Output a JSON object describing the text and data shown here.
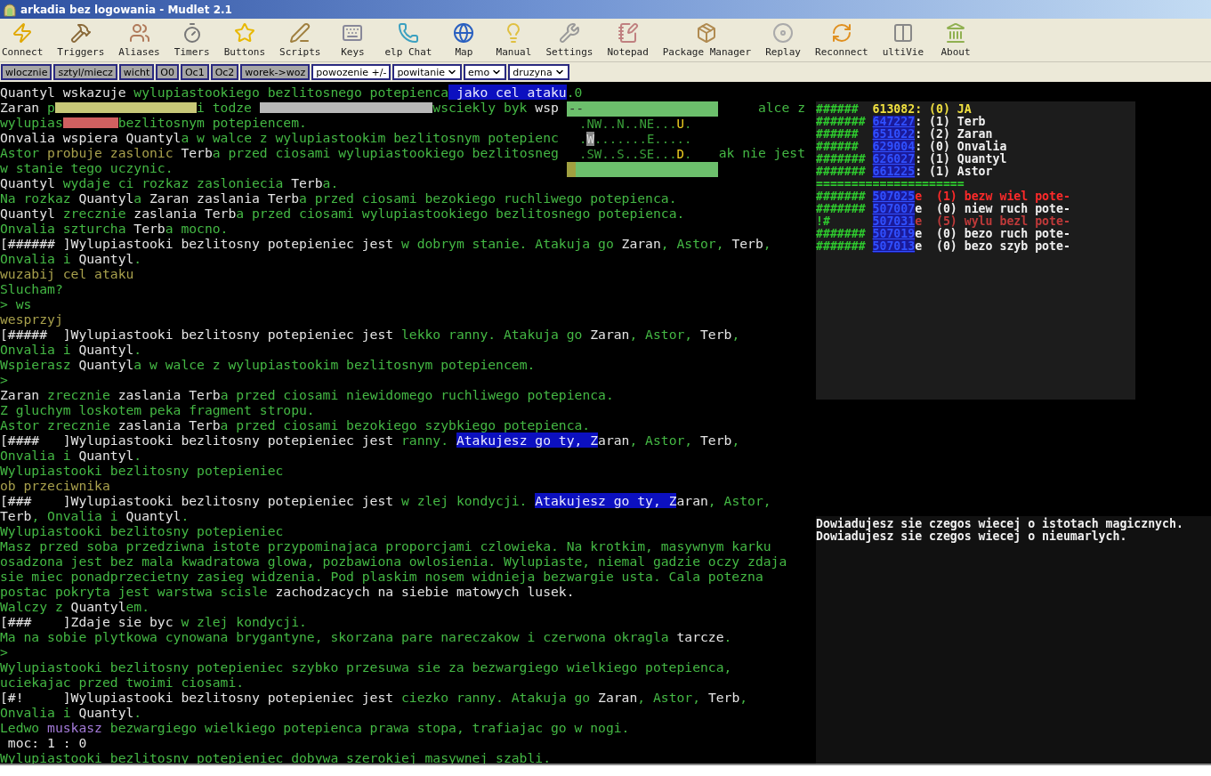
{
  "window": {
    "title": "arkadia bez logowania - Mudlet 2.1"
  },
  "toolbar": [
    {
      "label": "Connect",
      "kind": "connect"
    },
    {
      "label": "Triggers",
      "kind": "triggers"
    },
    {
      "label": "Aliases",
      "kind": "aliases"
    },
    {
      "label": "Timers",
      "kind": "timers"
    },
    {
      "label": "Buttons",
      "kind": "buttons"
    },
    {
      "label": "Scripts",
      "kind": "scripts"
    },
    {
      "label": "Keys",
      "kind": "keys"
    },
    {
      "label": "elp Chat",
      "kind": "chat"
    },
    {
      "label": "Map",
      "kind": "map"
    },
    {
      "label": "Manual",
      "kind": "manual"
    },
    {
      "label": "Settings",
      "kind": "settings"
    },
    {
      "label": "Notepad",
      "kind": "notepad"
    },
    {
      "label": "Package Manager",
      "kind": "packages"
    },
    {
      "label": "Replay",
      "kind": "replay"
    },
    {
      "label": "Reconnect",
      "kind": "reconnect"
    },
    {
      "label": "ultiVie",
      "kind": "multiview"
    },
    {
      "label": "About",
      "kind": "about"
    }
  ],
  "user_buttons": [
    {
      "label": "wlocznie",
      "kind": "button"
    },
    {
      "label": "sztyl/miecz",
      "kind": "button"
    },
    {
      "label": "wicht",
      "kind": "button"
    },
    {
      "label": "O0",
      "kind": "button"
    },
    {
      "label": "Oc1",
      "kind": "button"
    },
    {
      "label": "Oc2",
      "kind": "button"
    },
    {
      "label": "worek->woz",
      "kind": "button"
    },
    {
      "label": "powozenie +/-",
      "kind": "field"
    },
    {
      "label": "powitanie",
      "kind": "dropdown"
    },
    {
      "label": "emo",
      "kind": "dropdown"
    },
    {
      "label": "druzyna",
      "kind": "dropdown"
    }
  ],
  "console": [
    [
      {
        "kind": "name",
        "text": "Quantyl wskazuje "
      },
      {
        "kind": "text",
        "text": "wylupiastookiego bezlitosnego potepienca"
      },
      {
        "kind": "highlight",
        "text": " jako cel ataku"
      },
      {
        "kind": "text",
        "text": ".0"
      }
    ],
    [
      {
        "kind": "name",
        "text": "Zaran "
      },
      {
        "kind": "text",
        "text": "p"
      },
      {
        "kind": "smear",
        "color": "#c8c878"
      },
      {
        "kind": "text",
        "text": "i todze "
      },
      {
        "kind": "smear",
        "color": "#b8b8b8"
      },
      {
        "kind": "text",
        "text": "wsciekly byk "
      },
      {
        "kind": "name",
        "text": "wsp"
      },
      {
        "kind": "resume",
        "text": "alce z"
      }
    ],
    [
      {
        "kind": "text",
        "text": "wylupias"
      },
      {
        "kind": "smear",
        "color": "#d06060"
      },
      {
        "kind": "text",
        "text": "bezlitosnym potepiencem."
      }
    ],
    [
      {
        "kind": "name",
        "text": "Onvalia wspiera Quantyl"
      },
      {
        "kind": "text",
        "text": "a w walce z wylupiastookim bezlitosnym potepienc"
      }
    ],
    [
      {
        "kind": "text",
        "text": "Astor "
      },
      {
        "kind": "command",
        "text": "probuje zaslonic"
      },
      {
        "kind": "name",
        "text": " Terb"
      },
      {
        "kind": "text",
        "text": "a przed ciosami wylupiastookiego bezlitosneg"
      },
      {
        "kind": "resume",
        "text": "ak nie jest"
      }
    ],
    [
      {
        "kind": "text",
        "text": "w stanie tego uczynic."
      }
    ],
    [
      {
        "kind": "name",
        "text": "Quantyl "
      },
      {
        "kind": "text",
        "text": "wydaje ci rozkaz zasloniecia "
      },
      {
        "kind": "name",
        "text": "Terb"
      },
      {
        "kind": "text",
        "text": "a."
      }
    ],
    [
      {
        "kind": "text",
        "text": "Na rozkaz "
      },
      {
        "kind": "name",
        "text": "Quantyl"
      },
      {
        "kind": "text",
        "text": "a "
      },
      {
        "kind": "name",
        "text": "Zaran zaslania Terb"
      },
      {
        "kind": "text",
        "text": "a przed ciosami bezokiego ruchliwego potepienca."
      }
    ],
    [
      {
        "kind": "name",
        "text": "Quantyl "
      },
      {
        "kind": "text",
        "text": "zrecznie "
      },
      {
        "kind": "name",
        "text": "zaslania Terb"
      },
      {
        "kind": "text",
        "text": "a przed ciosami wylupiastookiego bezlitosnego potepienca."
      }
    ],
    [
      {
        "kind": "text",
        "text": "Onvalia szturcha "
      },
      {
        "kind": "name",
        "text": "Terb"
      },
      {
        "kind": "text",
        "text": "a mocno."
      }
    ],
    [
      {
        "kind": "name",
        "text": "[###### ]Wylupiastooki bezlitosny potepieniec jest "
      },
      {
        "kind": "text",
        "text": "w dobrym stanie. Atakuja go "
      },
      {
        "kind": "name",
        "text": "Zaran"
      },
      {
        "kind": "text",
        "text": ", Astor, "
      },
      {
        "kind": "name",
        "text": "Terb"
      },
      {
        "kind": "text",
        "text": ","
      }
    ],
    [
      {
        "kind": "text",
        "text": "Onvalia i "
      },
      {
        "kind": "name",
        "text": "Quantyl"
      },
      {
        "kind": "text",
        "text": "."
      }
    ],
    [
      {
        "kind": "command",
        "text": "wuzabij cel ataku"
      }
    ],
    [
      {
        "kind": "text",
        "text": "Slucham?"
      }
    ],
    [
      {
        "kind": "text",
        "text": "> ws"
      }
    ],
    [
      {
        "kind": "command",
        "text": "wesprzyj"
      }
    ],
    [
      {
        "kind": "name",
        "text": "[#####  ]Wylupiastooki bezlitosny potepieniec jest "
      },
      {
        "kind": "text",
        "text": "lekko ranny. Atakuja go "
      },
      {
        "kind": "name",
        "text": "Zaran"
      },
      {
        "kind": "text",
        "text": ", Astor, "
      },
      {
        "kind": "name",
        "text": "Terb"
      },
      {
        "kind": "text",
        "text": ","
      }
    ],
    [
      {
        "kind": "text",
        "text": "Onvalia i "
      },
      {
        "kind": "name",
        "text": "Quantyl"
      },
      {
        "kind": "text",
        "text": "."
      }
    ],
    [
      {
        "kind": "text",
        "text": "Wspierasz "
      },
      {
        "kind": "name",
        "text": "Quantyl"
      },
      {
        "kind": "text",
        "text": "a w walce z wylupiastookim bezlitosnym potepiencem."
      }
    ],
    [
      {
        "kind": "text",
        "text": ">"
      }
    ],
    [
      {
        "kind": "name",
        "text": "Zaran "
      },
      {
        "kind": "text",
        "text": "zrecznie "
      },
      {
        "kind": "name",
        "text": "zaslania Terb"
      },
      {
        "kind": "text",
        "text": "a przed ciosami niewidomego ruchliwego potepienca."
      }
    ],
    [
      {
        "kind": "text",
        "text": "Z gluchym loskotem peka fragment stropu."
      }
    ],
    [
      {
        "kind": "text",
        "text": "Astor zrecznie "
      },
      {
        "kind": "name",
        "text": "zaslania Terb"
      },
      {
        "kind": "text",
        "text": "a przed ciosami bezokiego szybkiego potepienca."
      }
    ],
    [
      {
        "kind": "name",
        "text": "[####   ]Wylupiastooki bezlitosny potepieniec jest "
      },
      {
        "kind": "text",
        "text": "ranny. "
      },
      {
        "kind": "highlight",
        "text": "Atakujesz go ty, Z"
      },
      {
        "kind": "name",
        "text": "aran"
      },
      {
        "kind": "text",
        "text": ", Astor, "
      },
      {
        "kind": "name",
        "text": "Terb"
      },
      {
        "kind": "text",
        "text": ","
      }
    ],
    [
      {
        "kind": "text",
        "text": "Onvalia i "
      },
      {
        "kind": "name",
        "text": "Quantyl"
      },
      {
        "kind": "text",
        "text": "."
      }
    ],
    [
      {
        "kind": "text",
        "text": "Wylupiastooki bezlitosny potepieniec"
      }
    ],
    [
      {
        "kind": "command",
        "text": "ob przeciwnika"
      }
    ],
    [
      {
        "kind": "name",
        "text": "[###    ]Wylupiastooki bezlitosny potepieniec jest "
      },
      {
        "kind": "text",
        "text": "w zlej kondycji. "
      },
      {
        "kind": "highlight",
        "text": "Atakujesz go ty, Z"
      },
      {
        "kind": "name",
        "text": "aran"
      },
      {
        "kind": "text",
        "text": ", Astor,"
      }
    ],
    [
      {
        "kind": "name",
        "text": "Terb"
      },
      {
        "kind": "text",
        "text": ", Onvalia i "
      },
      {
        "kind": "name",
        "text": "Quantyl"
      },
      {
        "kind": "text",
        "text": "."
      }
    ],
    [
      {
        "kind": "text",
        "text": "Wylupiastooki bezlitosny potepieniec"
      }
    ],
    [
      {
        "kind": "text",
        "text": "Masz przed soba przedziwna istote przypominajaca proporcjami czlowieka. Na krotkim, masywnym karku"
      }
    ],
    [
      {
        "kind": "text",
        "text": "osadzona jest bez mala kwadratowa glowa, pozbawiona owlosienia. Wylupiaste, niemal gadzie oczy zdaja"
      }
    ],
    [
      {
        "kind": "text",
        "text": "sie miec ponadprzecietny zasieg widzenia. Pod plaskim nosem widnieja bezwargie usta. Cala potezna"
      }
    ],
    [
      {
        "kind": "text",
        "text": "postac pokryta jest warstwa scisle "
      },
      {
        "kind": "name",
        "text": "zachodzacych na siebie matowych lusek."
      }
    ],
    [
      {
        "kind": "text",
        "text": "Walczy z "
      },
      {
        "kind": "name",
        "text": "Quantyl"
      },
      {
        "kind": "text",
        "text": "em."
      }
    ],
    [
      {
        "kind": "name",
        "text": "[###    ]Zdaje sie byc "
      },
      {
        "kind": "text",
        "text": "w zlej kondycji."
      }
    ],
    [
      {
        "kind": "text",
        "text": "Ma na sobie plytkowa cynowana brygantyne, skorzana pare nareczakow i czerwona okragla "
      },
      {
        "kind": "name",
        "text": "tarcze"
      },
      {
        "kind": "text",
        "text": "."
      }
    ],
    [
      {
        "kind": "text",
        "text": ">"
      }
    ],
    [
      {
        "kind": "text",
        "text": "Wylupiastooki bezlitosny potepieniec szybko przesuwa sie za bezwargiego wielkiego potepienca,"
      }
    ],
    [
      {
        "kind": "text",
        "text": "uciekajac przed twoimi ciosami."
      }
    ],
    [
      {
        "kind": "name",
        "text": "[#!     ]Wylupiastooki bezlitosny potepieniec jest "
      },
      {
        "kind": "text",
        "text": "ciezko ranny. Atakuja go "
      },
      {
        "kind": "name",
        "text": "Zaran"
      },
      {
        "kind": "text",
        "text": ", Astor, "
      },
      {
        "kind": "name",
        "text": "Terb"
      },
      {
        "kind": "text",
        "text": ","
      }
    ],
    [
      {
        "kind": "text",
        "text": "Onvalia i "
      },
      {
        "kind": "name",
        "text": "Quantyl"
      },
      {
        "kind": "text",
        "text": "."
      }
    ],
    [
      {
        "kind": "text",
        "text": "Ledwo "
      },
      {
        "kind": "strike",
        "text": "muskasz"
      },
      {
        "kind": "text",
        "text": " bezwargiego wielkiego potepienca prawa stopa, trafiajac go w nogi."
      }
    ],
    [
      {
        "kind": "name",
        "text": " moc: 1 : 0"
      }
    ],
    [
      {
        "kind": "text",
        "text": "Wylupiastooki bezlitosny potepieniec dobywa szerokiej masywnej szabli."
      }
    ]
  ],
  "map": {
    "top_bar": "--",
    "rows": [
      {
        "kind": "exit",
        "left": ".NW..N..NE...",
        "mark": "U",
        "right": "."
      },
      {
        "kind": "here",
        "left": ".",
        "mark": "W",
        "right": ".......E....."
      },
      {
        "kind": "exit",
        "left": ".SW..S..SE...",
        "mark": "D",
        "right": "."
      }
    ]
  },
  "team": [
    {
      "kind": "self",
      "hashes": "######",
      "id": "613082",
      "rest": ": (0) JA"
    },
    {
      "kind": "member",
      "hashes": "#######",
      "id": "647227",
      "rest": ": (1) Terb"
    },
    {
      "kind": "member",
      "hashes": "######",
      "id": "651022",
      "rest": ": (2) Zaran"
    },
    {
      "kind": "member",
      "hashes": "######",
      "id": "629004",
      "rest": ": (0) Onvalia"
    },
    {
      "kind": "member",
      "hashes": "#######",
      "id": "626027",
      "rest": ": (1) Quantyl"
    },
    {
      "kind": "member",
      "hashes": "#######",
      "id": "661225",
      "rest": ": (1) Astor"
    }
  ],
  "separator": "=====================",
  "enemies": [
    {
      "kind": "target",
      "hashes": "#######",
      "id": "507025",
      "suffix": "e",
      "rest": "(1) bezw wiel pote-"
    },
    {
      "kind": "normal",
      "hashes": "#######",
      "id": "507007",
      "suffix": "e",
      "rest": "(0) niew ruch pote-"
    },
    {
      "kind": "attacked",
      "hashes": "!#",
      "id": "507031",
      "suffix": "e",
      "rest": "(5) wylu bezl pote-"
    },
    {
      "kind": "normal",
      "hashes": "#######",
      "id": "507019",
      "suffix": "e",
      "rest": "(0) bezo ruch pote-"
    },
    {
      "kind": "normal",
      "hashes": "#######",
      "id": "507013",
      "suffix": "e",
      "rest": "(0) bezo szyb pote-"
    }
  ],
  "messages": [
    "Dowiadujesz sie czegos wiecej o istotach magicznych.",
    "Dowiadujesz sie czegos wiecej o nieumarlych."
  ]
}
